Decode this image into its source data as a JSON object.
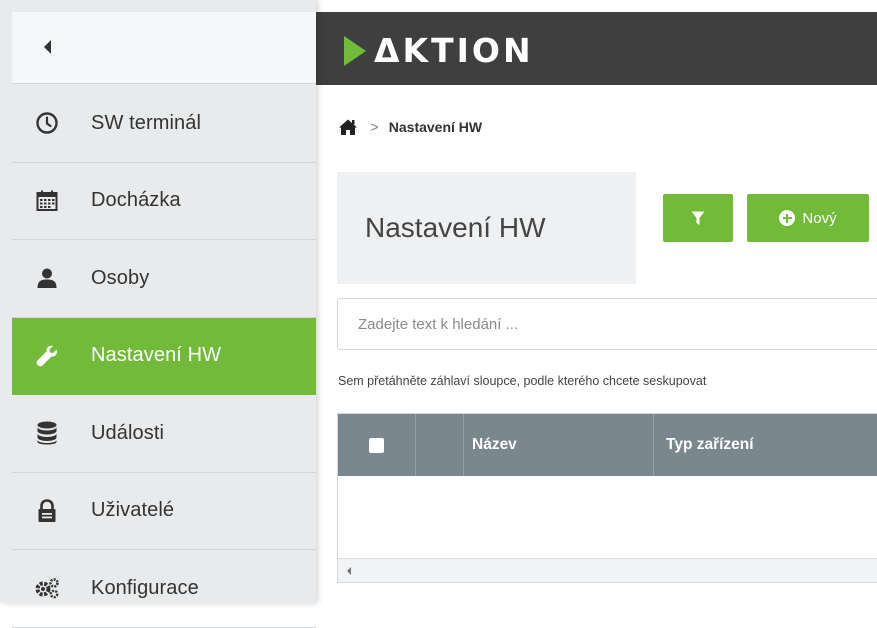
{
  "header": {
    "logo_text": "ΔKTION"
  },
  "sidebar": {
    "items": [
      {
        "label": "SW terminál",
        "icon": "clock-icon",
        "active": false
      },
      {
        "label": "Docházka",
        "icon": "calendar-icon",
        "active": false
      },
      {
        "label": "Osoby",
        "icon": "person-icon",
        "active": false
      },
      {
        "label": "Nastavení HW",
        "icon": "wrench-icon",
        "active": true
      },
      {
        "label": "Události",
        "icon": "database-icon",
        "active": false
      },
      {
        "label": "Uživatelé",
        "icon": "lock-icon",
        "active": false
      },
      {
        "label": "Konfigurace",
        "icon": "gears-icon",
        "active": false
      }
    ]
  },
  "breadcrumb": {
    "separator": ">",
    "current": "Nastavení HW"
  },
  "page": {
    "title": "Nastavení HW"
  },
  "toolbar": {
    "new_label": "Nový"
  },
  "search": {
    "placeholder": "Zadejte text k hledání ..."
  },
  "grid": {
    "group_hint": "Sem přetáhněte záhlaví sloupce, podle kterého chcete seskupovat",
    "columns": [
      "Název",
      "Typ zařízení"
    ]
  },
  "colors": {
    "accent": "#71ba3a",
    "topbar": "#3f3f3f",
    "grid_header": "#7b878f",
    "sidebar": "#e8eaec"
  }
}
